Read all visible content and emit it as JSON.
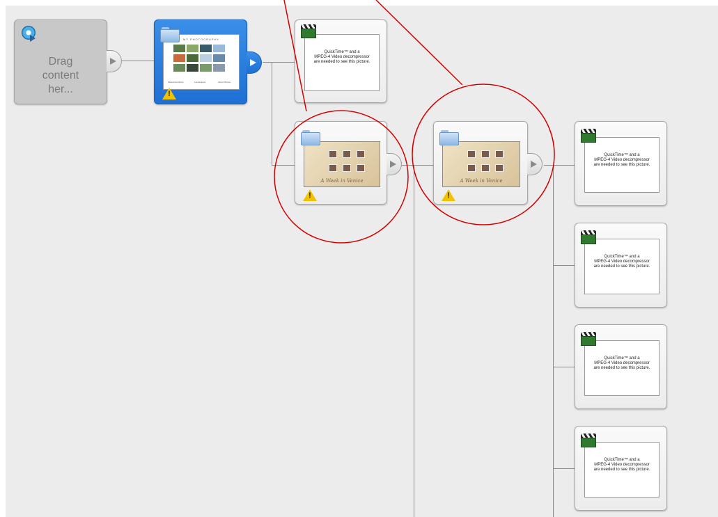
{
  "drop_tile": {
    "label": "Drag\ncontent\nher..."
  },
  "video_tile": {
    "text": "QuickTime™ and a\nMPEG-4 Video decompressor\nare needed to see this picture."
  },
  "menu_preview": {
    "title": "A Week in Venice"
  },
  "photo_menu": {
    "heading": "MY PHOTOGRAPHY",
    "footer": [
      "Slideshow Movie",
      "Landscapes",
      "About Photos"
    ]
  },
  "colors": {
    "selected": "#1f6fd4",
    "callout": "#d40000",
    "warning": "#f2c200",
    "connector": "#8a8a8a"
  }
}
